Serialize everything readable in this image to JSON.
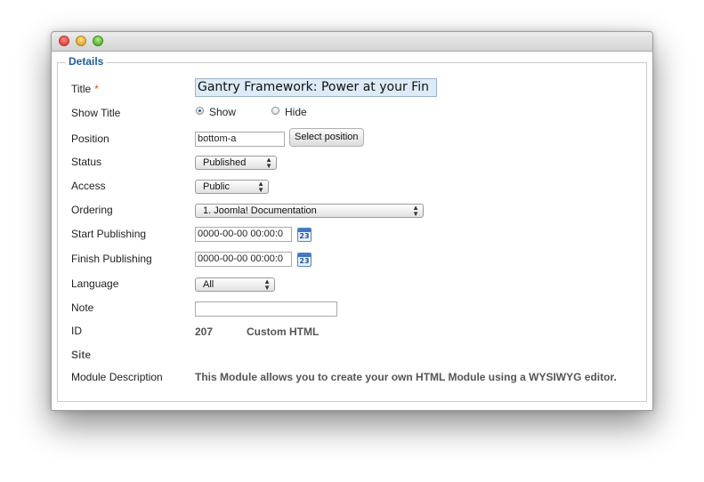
{
  "form": {
    "legend": "Details",
    "title": {
      "label": "Title",
      "required_mark": "*",
      "value": "Gantry Framework: Power at your Fin"
    },
    "show_title": {
      "label": "Show Title",
      "options": [
        "Show",
        "Hide"
      ],
      "selected": "Show"
    },
    "position": {
      "label": "Position",
      "value": "bottom-a",
      "button": "Select position"
    },
    "status": {
      "label": "Status",
      "value": "Published"
    },
    "access": {
      "label": "Access",
      "value": "Public"
    },
    "ordering": {
      "label": "Ordering",
      "value": "1. Joomla! Documentation"
    },
    "start_publishing": {
      "label": "Start Publishing",
      "value": "0000-00-00 00:00:0",
      "calendar_day": "23"
    },
    "finish_publishing": {
      "label": "Finish Publishing",
      "value": "0000-00-00 00:00:0",
      "calendar_day": "23"
    },
    "language": {
      "label": "Language",
      "value": "All"
    },
    "note": {
      "label": "Note",
      "value": ""
    },
    "id": {
      "label": "ID",
      "value": "207",
      "type": "Custom HTML"
    },
    "site_heading": "Site",
    "module_description": {
      "label": "Module Description",
      "value": "This Module allows you to create your own HTML Module using a WYSIWYG editor."
    }
  },
  "select_arrows": "▲\n▼",
  "colors": {
    "legend": "#1f5c99",
    "required": "#e74c16",
    "title_bg": "#dcebf7"
  }
}
